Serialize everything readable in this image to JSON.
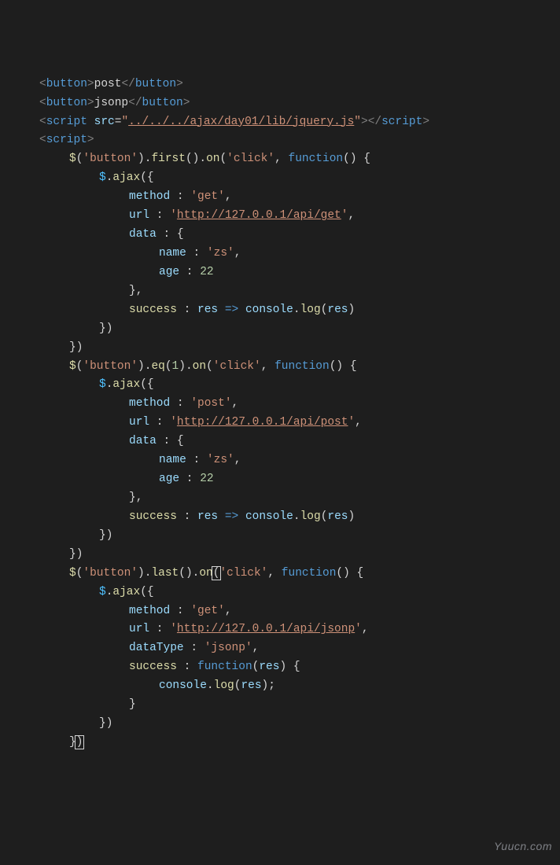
{
  "code": {
    "button1_tag": "button",
    "button1_text": "post",
    "button2_tag": "button",
    "button2_text": "jsonp",
    "script_tag": "script",
    "src_attr": "src",
    "script_src": "../../../ajax/day01/lib/jquery.js",
    "jquery": "$",
    "ajax_fn": "ajax",
    "button_sel": "'button'",
    "first_fn": "first",
    "eq_fn": "eq",
    "eq_arg": "1",
    "last_fn": "last",
    "on_fn": "on",
    "click_evt": "'click'",
    "function_kw": "function",
    "method_prop": "method",
    "url_prop": "url",
    "data_prop": "data",
    "name_prop": "name",
    "age_prop": "age",
    "success_prop": "success",
    "dataType_prop": "dataType",
    "get_val": "'get'",
    "post_val": "'post'",
    "jsonp_val": "'jsonp'",
    "url_get_q": "'",
    "url_get": "http://127.0.0.1/api/get",
    "url_post": "http://127.0.0.1/api/post",
    "url_jsonp": "http://127.0.0.1/api/jsonp",
    "zs_val": "'zs'",
    "age_val": "22",
    "res_param": "res",
    "arrow": "=>",
    "console": "console",
    "log_fn": "log"
  },
  "watermark": "Yuucn.com"
}
